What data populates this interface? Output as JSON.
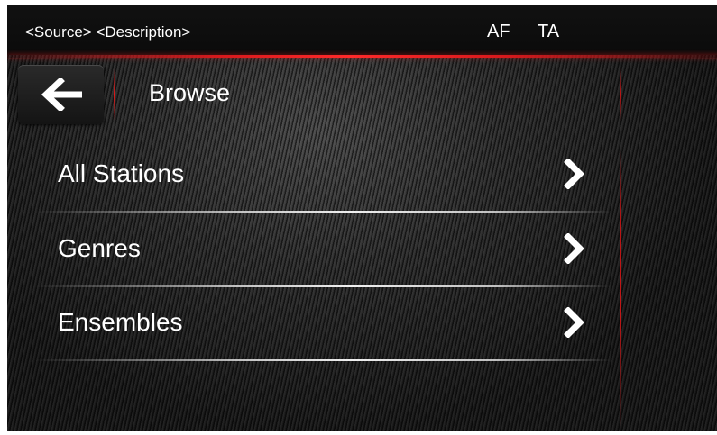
{
  "status_bar": {
    "source_description": "<Source> <Description>",
    "af": "AF",
    "ta": "TA"
  },
  "header": {
    "back_icon": "arrow-left-icon",
    "title": "Browse"
  },
  "menu": {
    "items": [
      {
        "label": "All Stations",
        "icon": "chevron-right-icon"
      },
      {
        "label": "Genres",
        "icon": "chevron-right-icon"
      },
      {
        "label": "Ensembles",
        "icon": "chevron-right-icon"
      }
    ]
  },
  "colors": {
    "accent_red": "#d8191c",
    "text": "#ffffff",
    "background": "#1d1d1d"
  }
}
